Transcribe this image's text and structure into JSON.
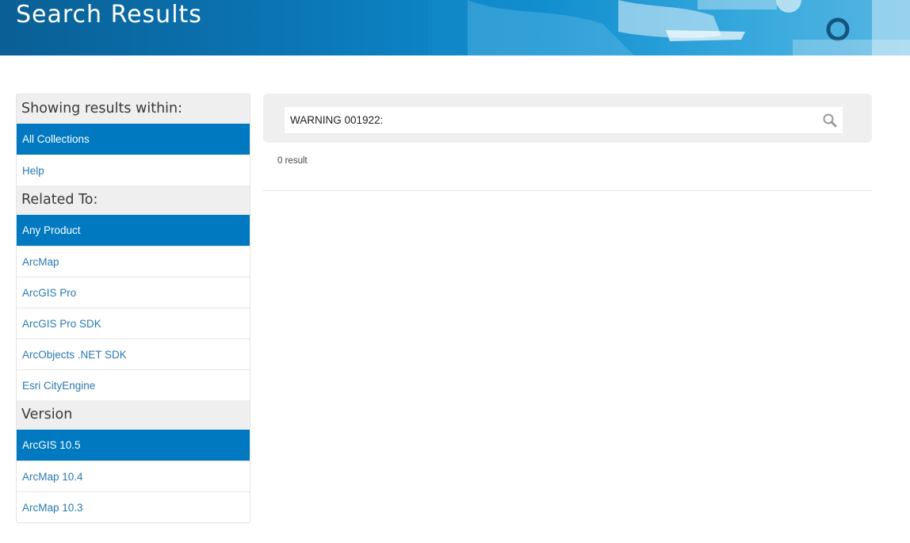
{
  "banner": {
    "title": "Search Results"
  },
  "sidebar": {
    "sections": [
      {
        "heading": "Showing results within:",
        "items": [
          {
            "label": "All Collections",
            "active": true
          },
          {
            "label": "Help",
            "active": false
          }
        ]
      },
      {
        "heading": "Related To:",
        "items": [
          {
            "label": "Any Product",
            "active": true
          },
          {
            "label": "ArcMap",
            "active": false
          },
          {
            "label": "ArcGIS Pro",
            "active": false
          },
          {
            "label": "ArcGIS Pro SDK",
            "active": false
          },
          {
            "label": "ArcObjects .NET SDK",
            "active": false
          },
          {
            "label": "Esri CityEngine",
            "active": false
          }
        ]
      },
      {
        "heading": "Version",
        "items": [
          {
            "label": "ArcGIS 10.5",
            "active": true
          },
          {
            "label": "ArcMap 10.4",
            "active": false
          },
          {
            "label": "ArcMap 10.3",
            "active": false
          }
        ]
      }
    ]
  },
  "search": {
    "value": "WARNING 001922:",
    "icon": "search-icon"
  },
  "results": {
    "count_label": "0 result"
  },
  "colors": {
    "accent": "#0079c1",
    "link": "#2a7ab0",
    "panel": "#efefef"
  }
}
